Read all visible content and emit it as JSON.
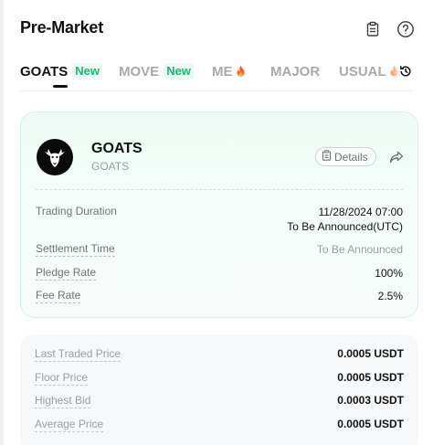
{
  "header": {
    "title": "Pre-Market",
    "icons": {
      "clipboard": "clipboard-icon",
      "help": "help-icon"
    }
  },
  "tabs": [
    {
      "label": "GOATS",
      "badge": "New",
      "active": true
    },
    {
      "label": "MOVE",
      "badge": "New",
      "active": false
    },
    {
      "label": "ME",
      "icon": "flame-icon",
      "active": false
    },
    {
      "label": "MAJOR",
      "active": false
    },
    {
      "label": "USUAL",
      "icon": "flame-icon",
      "active": false
    }
  ],
  "card": {
    "token_name": "GOATS",
    "token_symbol": "GOATS",
    "details_label": "Details",
    "rows": {
      "trading_duration": {
        "label": "Trading Duration",
        "value_line1": "11/28/2024 07:00",
        "value_line2": "To Be Announced(UTC)"
      },
      "settlement_time": {
        "label": "Settlement Time",
        "value": "To Be Announced"
      },
      "pledge_rate": {
        "label": "Pledge Rate",
        "value": "100%"
      },
      "fee_rate": {
        "label": "Fee Rate",
        "value": "2.5%"
      }
    }
  },
  "prices": {
    "last_traded": {
      "label": "Last Traded Price",
      "value": "0.0005 USDT"
    },
    "floor": {
      "label": "Floor Price",
      "value": "0.0005 USDT"
    },
    "highest_bid": {
      "label": "Highest Bid",
      "value": "0.0003 USDT"
    },
    "average": {
      "label": "Average Price",
      "value": "0.0005 USDT"
    }
  },
  "colors": {
    "accent_green": "#17b978",
    "badge_bg": "#e8faf1",
    "flame": "#ff5a1f",
    "card_border": "#d5f2e5"
  }
}
